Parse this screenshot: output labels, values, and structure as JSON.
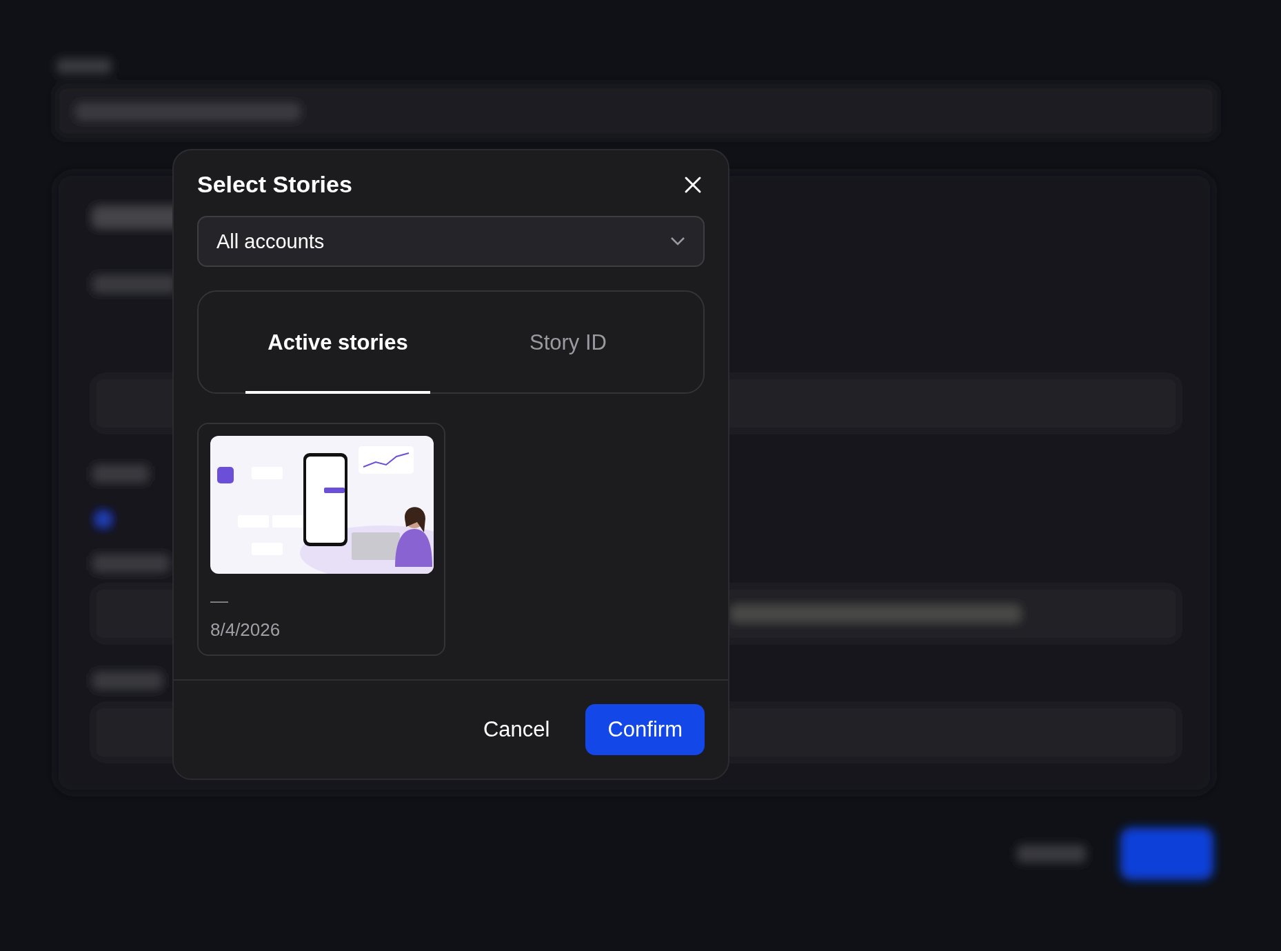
{
  "dialog": {
    "title": "Select Stories",
    "account_select": {
      "value": "All accounts"
    },
    "tabs": [
      {
        "label": "Active stories",
        "selected": true
      },
      {
        "label": "Story ID",
        "selected": false
      }
    ],
    "stories": [
      {
        "kind": "picture",
        "caption": "—",
        "date": "8/4/2026",
        "selected": false
      }
    ],
    "buttons": [
      {
        "label": "Cancel",
        "kind": "secondary"
      },
      {
        "label": "Confirm",
        "kind": "primary"
      }
    ]
  }
}
